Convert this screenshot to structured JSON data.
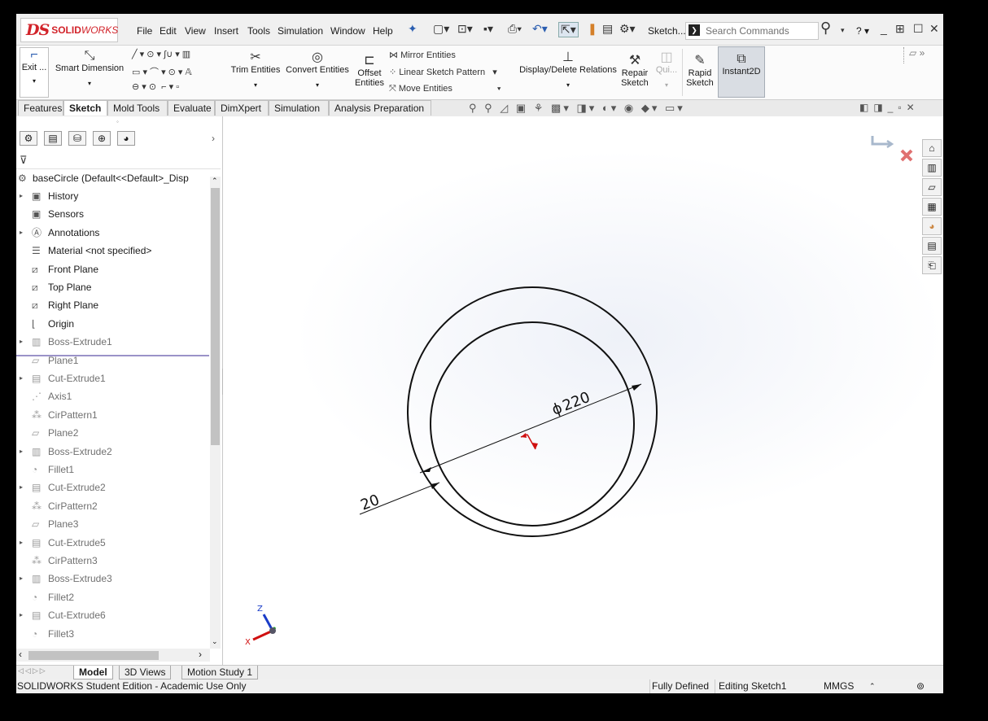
{
  "app": {
    "brand_ds": "DS",
    "brand_name": "SOLID",
    "brand_name_italic": "WORKS"
  },
  "menu": [
    "File",
    "Edit",
    "View",
    "Insert",
    "Tools",
    "Simulation",
    "Window",
    "Help"
  ],
  "toolbar": {
    "sketch_label": "Sketch...",
    "search_placeholder": "Search Commands",
    "help": "?"
  },
  "ribbon": {
    "exit": "Exit ...",
    "smart_dimension": "Smart Dimension",
    "trim_entities": "Trim Entities",
    "convert_entities": "Convert Entities",
    "offset_entities": "Offset Entities",
    "offset_line1": "Offset",
    "offset_line2": "Entities",
    "mirror_entities": "Mirror Entities",
    "linear_sketch_pattern": "Linear Sketch Pattern",
    "move_entities": "Move Entities",
    "display_delete_relations": "Display/Delete Relations",
    "repair_line1": "Repair",
    "repair_line2": "Sketch",
    "quick": "Qui...",
    "rapid_line1": "Rapid",
    "rapid_line2": "Sketch",
    "instant2d": "Instant2D"
  },
  "tabs": [
    "Features",
    "Sketch",
    "Mold Tools",
    "Evaluate",
    "DimXpert",
    "Simulation",
    "Analysis Preparation"
  ],
  "active_tab": "Sketch",
  "tree": {
    "root": "baseCircle  (Default<<Default>_Disp",
    "items": [
      {
        "label": "History",
        "icon": "history-icon",
        "expand": true,
        "dim": false
      },
      {
        "label": "Sensors",
        "icon": "sensors-icon",
        "expand": false,
        "dim": false
      },
      {
        "label": "Annotations",
        "icon": "annotations-icon",
        "expand": true,
        "dim": false
      },
      {
        "label": "Material <not specified>",
        "icon": "material-icon",
        "expand": false,
        "dim": false
      },
      {
        "label": "Front Plane",
        "icon": "plane-icon",
        "expand": false,
        "dim": false
      },
      {
        "label": "Top Plane",
        "icon": "plane-icon",
        "expand": false,
        "dim": false
      },
      {
        "label": "Right Plane",
        "icon": "plane-icon",
        "expand": false,
        "dim": false
      },
      {
        "label": "Origin",
        "icon": "origin-icon",
        "expand": false,
        "dim": false
      },
      {
        "label": "Boss-Extrude1",
        "icon": "extrude-icon",
        "expand": true,
        "dim": true
      },
      {
        "label": "Plane1",
        "icon": "plane-feature-icon",
        "expand": false,
        "dim": true
      },
      {
        "label": "Cut-Extrude1",
        "icon": "cut-extrude-icon",
        "expand": true,
        "dim": true
      },
      {
        "label": "Axis1",
        "icon": "axis-icon",
        "expand": false,
        "dim": true
      },
      {
        "label": "CirPattern1",
        "icon": "pattern-icon",
        "expand": false,
        "dim": true
      },
      {
        "label": "Plane2",
        "icon": "plane-feature-icon",
        "expand": false,
        "dim": true
      },
      {
        "label": "Boss-Extrude2",
        "icon": "extrude-icon",
        "expand": true,
        "dim": true
      },
      {
        "label": "Fillet1",
        "icon": "fillet-icon",
        "expand": false,
        "dim": true
      },
      {
        "label": "Cut-Extrude2",
        "icon": "cut-extrude-icon",
        "expand": true,
        "dim": true
      },
      {
        "label": "CirPattern2",
        "icon": "pattern-icon",
        "expand": false,
        "dim": true
      },
      {
        "label": "Plane3",
        "icon": "plane-feature-icon",
        "expand": false,
        "dim": true
      },
      {
        "label": "Cut-Extrude5",
        "icon": "cut-extrude-icon",
        "expand": true,
        "dim": true
      },
      {
        "label": "CirPattern3",
        "icon": "pattern-icon",
        "expand": false,
        "dim": true
      },
      {
        "label": "Boss-Extrude3",
        "icon": "extrude-icon",
        "expand": true,
        "dim": true
      },
      {
        "label": "Fillet2",
        "icon": "fillet-icon",
        "expand": false,
        "dim": true
      },
      {
        "label": "Cut-Extrude6",
        "icon": "cut-extrude-icon",
        "expand": true,
        "dim": true
      },
      {
        "label": "Fillet3",
        "icon": "fillet-icon",
        "expand": false,
        "dim": true
      }
    ]
  },
  "sketch": {
    "diameter_dim": "220",
    "diameter_symbol": "ϕ",
    "offset_dim": "20",
    "triad_z": "Z",
    "triad_x": "X"
  },
  "bottom_tabs": [
    "Model",
    "3D Views",
    "Motion Study 1"
  ],
  "status": {
    "left": "SOLIDWORKS Student Edition - Academic Use Only",
    "defined": "Fully Defined",
    "editing": "Editing Sketch1",
    "units": "MMGS"
  }
}
